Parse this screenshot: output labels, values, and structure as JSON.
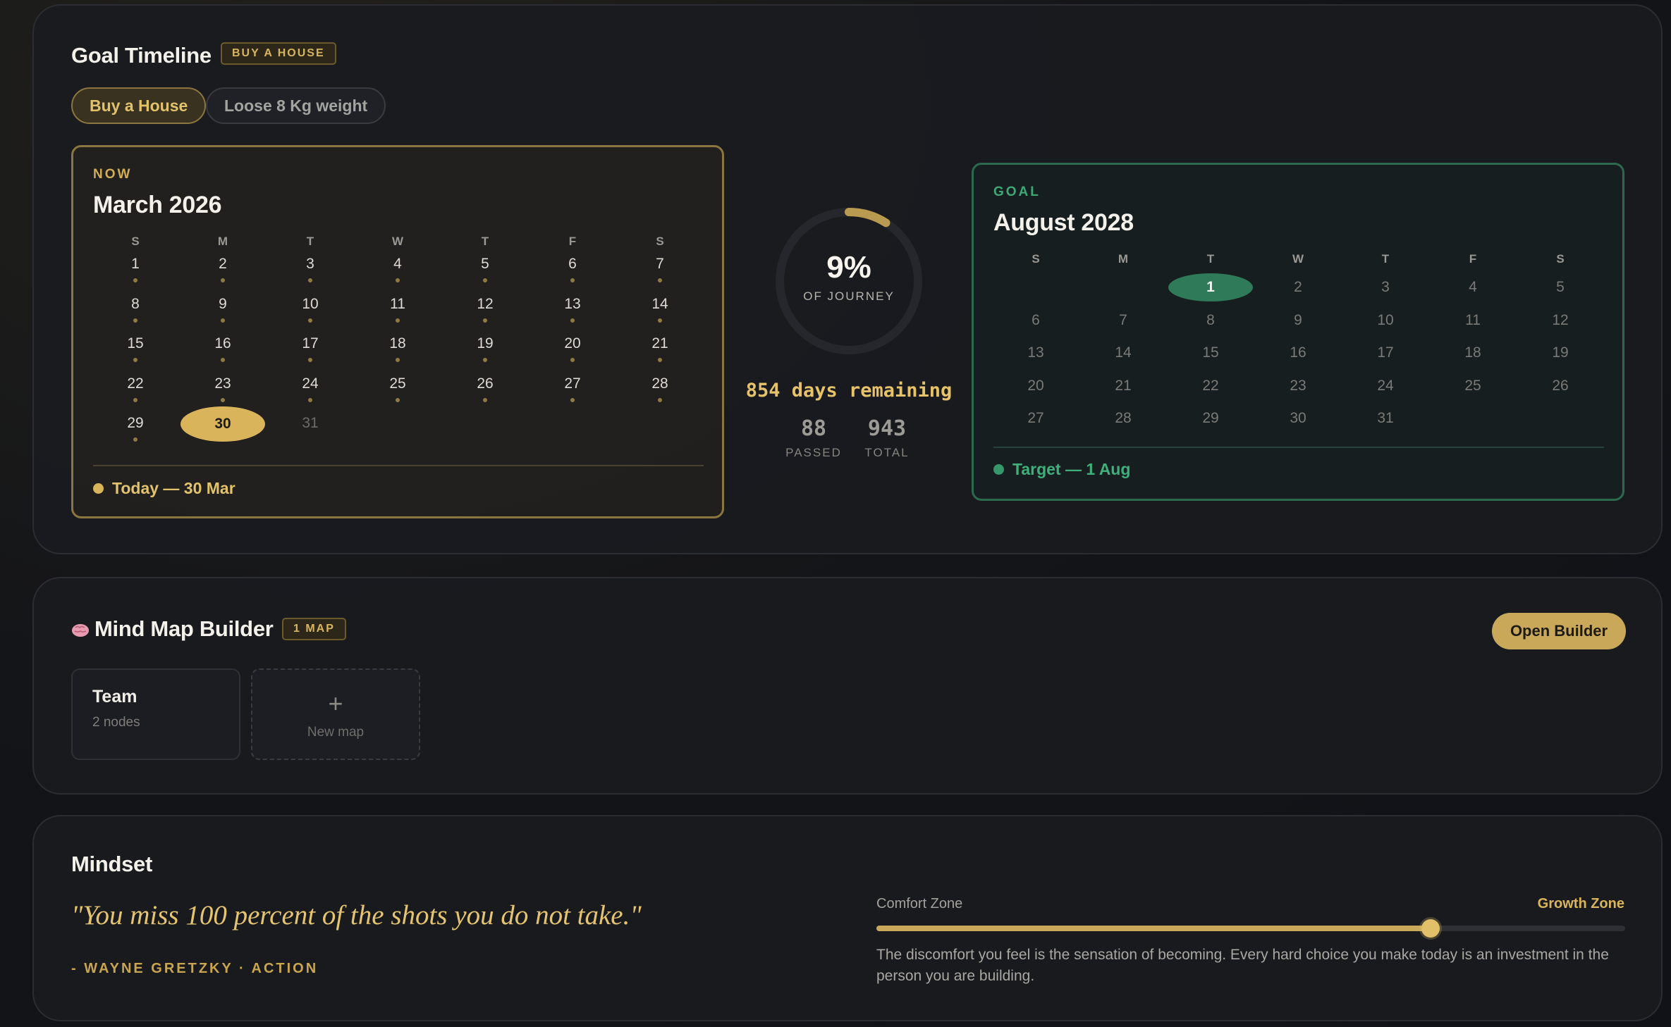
{
  "timeline": {
    "title": "Goal Timeline",
    "badge": "BUY A HOUSE",
    "tabs": [
      {
        "label": "Buy a House",
        "active": true
      },
      {
        "label": "Loose 8 Kg weight",
        "active": false
      }
    ],
    "now": {
      "eyebrow": "NOW",
      "month": "March 2026",
      "weekdays": [
        "S",
        "M",
        "T",
        "W",
        "T",
        "F",
        "S"
      ],
      "first_weekday": 0,
      "days_in_month": 31,
      "today": 30,
      "footer": "Today — 30 Mar"
    },
    "progress": {
      "percent_label": "9%",
      "percent": 9,
      "sub": "OF JOURNEY",
      "remaining": "854 days remaining",
      "passed_value": "88",
      "passed_label": "PASSED",
      "total_value": "943",
      "total_label": "TOTAL"
    },
    "goal": {
      "eyebrow": "GOAL",
      "month": "August 2028",
      "weekdays": [
        "S",
        "M",
        "T",
        "W",
        "T",
        "F",
        "S"
      ],
      "first_weekday": 2,
      "days_in_month": 31,
      "target_day": 1,
      "footer": "Target — 1 Aug"
    }
  },
  "mindmap": {
    "icon": "brain-icon",
    "title": "Mind Map Builder",
    "badge": "1 MAP",
    "open_button": "Open Builder",
    "maps": [
      {
        "name": "Team",
        "meta": "2 nodes"
      }
    ],
    "new_map": {
      "icon": "+",
      "label": "New map"
    }
  },
  "mindset": {
    "title": "Mindset",
    "quote": "\"You miss 100 percent of the shots you do not take.\"",
    "author": "- WAYNE GRETZKY · ACTION",
    "slider": {
      "left_label": "Comfort Zone",
      "right_label": "Growth Zone",
      "value": 0.74
    },
    "text": "The discomfort you feel is the sensation of becoming. Every hard choice you make today is an investment in the person you are building."
  },
  "colors": {
    "accent": "#c9a85a",
    "goal": "#2f7a58",
    "background": "#15161b"
  }
}
